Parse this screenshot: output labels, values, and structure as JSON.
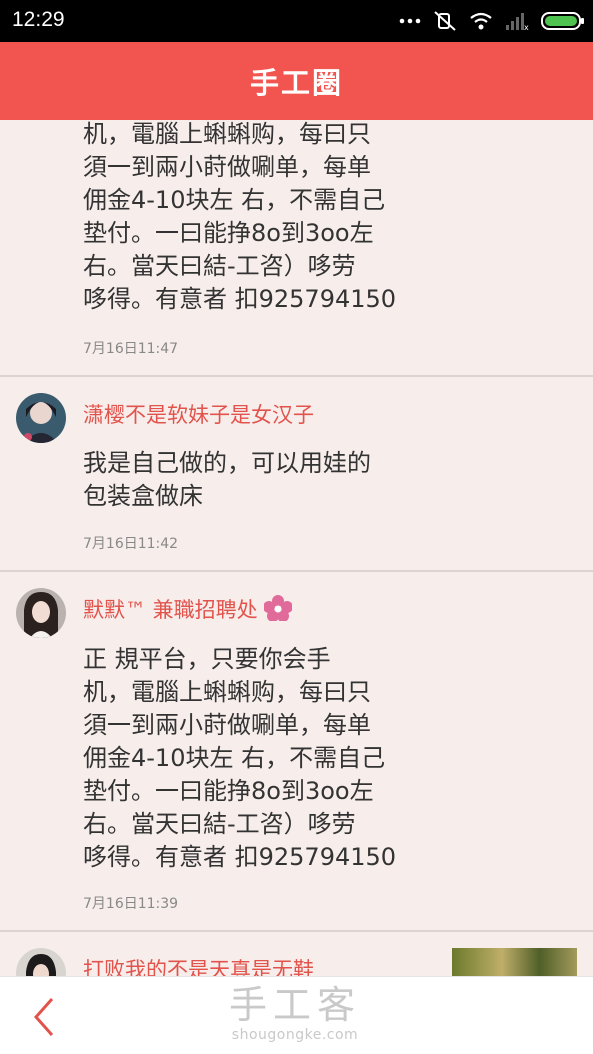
{
  "status_bar": {
    "time": "12:29",
    "icons": [
      "more-dots-icon",
      "mute-icon",
      "wifi-icon",
      "signal-icon",
      "battery-icon"
    ]
  },
  "header": {
    "title": "手工圈"
  },
  "posts": [
    {
      "body": "机，電腦上蝌蝌购，每曰只\n須一到兩小莳做唰单，每单\n佣金4-10块左  右，不需自己\n垫付。一曰能挣8o到3oo左\n右。當天曰結-工咨）哆劳\n哆得。有意者 扣925794150",
      "time": "7月16日11:47"
    },
    {
      "author": "潇樱不是软妹子是女汉子",
      "body": "我是自己做的，可以用娃的\n包装盒做床",
      "time": "7月16日11:42"
    },
    {
      "author": "默默™ 兼職招聘处",
      "body": "正 規平台，只要你会手\n机，電腦上蝌蝌购，每曰只\n須一到兩小莳做唰单，每单\n佣金4-10块左  右，不需自己\n垫付。一曰能挣8o到3oo左\n右。當天曰結-工咨）哆劳\n哆得。有意者 扣925794150",
      "time": "7月16日11:39"
    },
    {
      "author": "打败我的不是天真是无鞋"
    }
  ],
  "bottom_bar": {
    "watermark_cn": "手工客",
    "watermark_en": "shougongke.com"
  },
  "colors": {
    "accent": "#f2544f",
    "author": "#e2534c",
    "background": "#f7eeec"
  }
}
